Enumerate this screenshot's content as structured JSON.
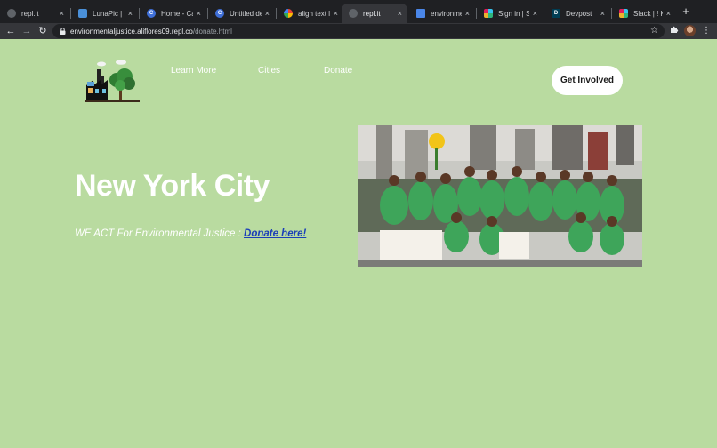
{
  "browser": {
    "tabs": [
      {
        "title": "repl.it",
        "icon": "replit-icon",
        "color": "#5f6368"
      },
      {
        "title": "LunaPic | Fr",
        "icon": "lunapic-icon",
        "color": "#4a90d9"
      },
      {
        "title": "Home - Can",
        "icon": "canva-icon",
        "color": "#3f6fd8"
      },
      {
        "title": "Untitled des",
        "icon": "canva-icon",
        "color": "#3f6fd8"
      },
      {
        "title": "align text lef",
        "icon": "google-icon",
        "color": "#ffffff"
      },
      {
        "title": "repl.it",
        "icon": "replit-icon",
        "color": "#5f6368",
        "active": true
      },
      {
        "title": "environment",
        "icon": "docs-icon",
        "color": "#4a86e8"
      },
      {
        "title": "Sign in | Sla",
        "icon": "slack-icon",
        "color": "#e01e5a"
      },
      {
        "title": "Devpost",
        "icon": "devpost-icon",
        "color": "#003e54",
        "glyph": "D"
      },
      {
        "title": "Slack | ! Kim",
        "icon": "slack-icon",
        "color": "#e01e5a"
      }
    ],
    "close_glyph": "×",
    "new_tab_glyph": "+",
    "url_host": "environmentaljustice.aliflores09.repl.co",
    "url_path": "/donate.html"
  },
  "nav": {
    "links": [
      "Learn More",
      "Cities",
      "Donate"
    ],
    "cta": "Get Involved"
  },
  "main": {
    "heading": "New York City",
    "tagline": "WE ACT For Environmental Justice : ",
    "donate_link": "Donate here!"
  }
}
